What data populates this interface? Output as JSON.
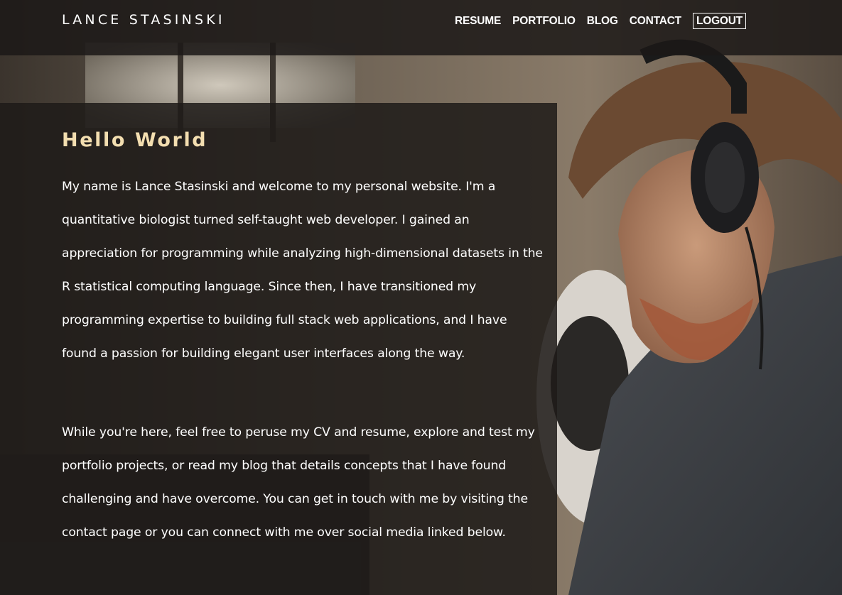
{
  "site": {
    "brand": "LANCE STASINSKI"
  },
  "nav": {
    "items": [
      {
        "label": "RESUME"
      },
      {
        "label": "PORTFOLIO"
      },
      {
        "label": "BLOG"
      },
      {
        "label": "CONTACT"
      },
      {
        "label": "LOGOUT"
      }
    ]
  },
  "main": {
    "heading": "Hello World",
    "paragraphs": [
      "My name is Lance Stasinski and welcome to my personal website. I'm a quantitative biologist turned self-taught web developer. I gained an appreciation for programming while analyzing high-dimensional datasets in the R statistical computing language. Since then, I have transitioned my programming expertise to building full stack web applications, and I have found a passion for building elegant user interfaces along the way.",
      "While you're here, feel free to peruse my CV and resume, explore and test my portfolio projects, or read my blog that details concepts that I have found challenging and have overcome. You can get in touch with me by visiting the contact page or you can connect with me over social media linked below."
    ]
  },
  "colors": {
    "heading_accent": "#f3deb0",
    "nav_background": "#1c1917",
    "panel_background": "#1e1b19",
    "text": "#ffffff"
  }
}
